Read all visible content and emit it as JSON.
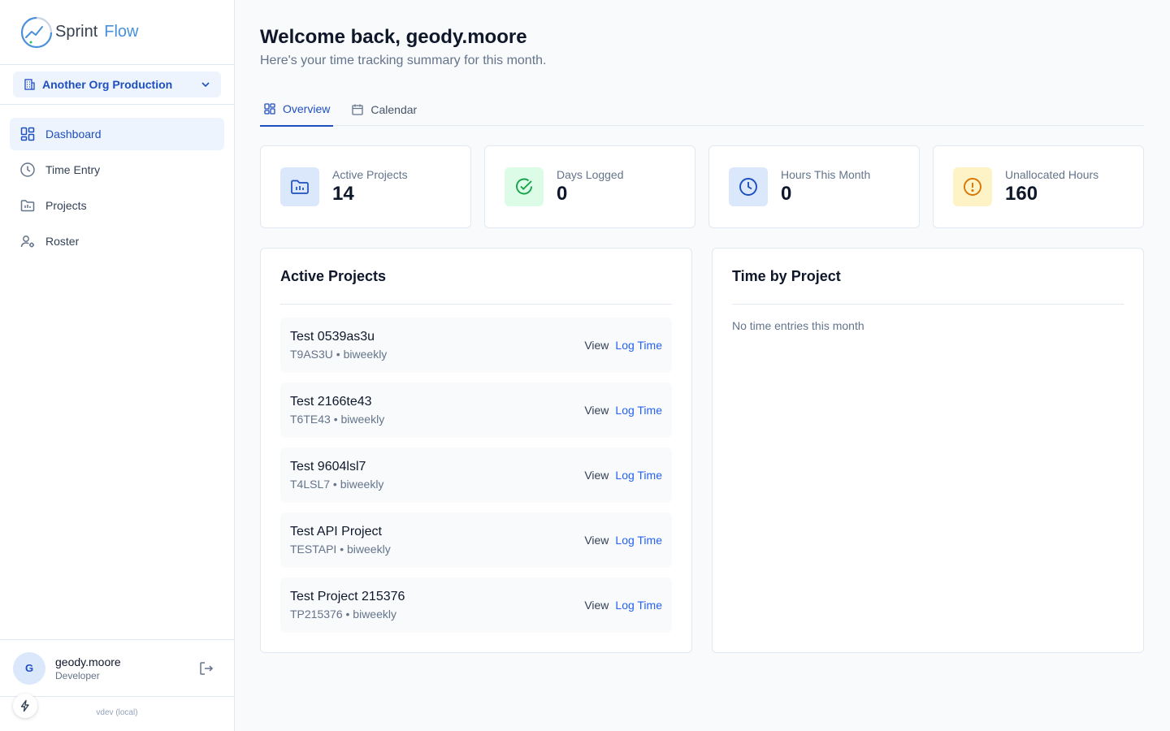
{
  "brand": {
    "part1": "Sprint",
    "part2": "Flow"
  },
  "org": {
    "selected": "Another Org Production"
  },
  "nav": [
    {
      "label": "Dashboard",
      "icon": "dashboard-icon",
      "active": true
    },
    {
      "label": "Time Entry",
      "icon": "clock-icon",
      "active": false
    },
    {
      "label": "Projects",
      "icon": "folder-icon",
      "active": false
    },
    {
      "label": "Roster",
      "icon": "users-icon",
      "active": false
    }
  ],
  "user": {
    "initial": "G",
    "name": "geody.moore",
    "role": "Developer",
    "version": "vdev (local)"
  },
  "header": {
    "title": "Welcome back, geody.moore",
    "subtitle": "Here's your time tracking summary for this month."
  },
  "tabs": [
    {
      "label": "Overview",
      "icon": "grid-icon",
      "active": true
    },
    {
      "label": "Calendar",
      "icon": "calendar-icon",
      "active": false
    }
  ],
  "stats": [
    {
      "label": "Active Projects",
      "value": "14",
      "icon": "folder-chart-icon",
      "bg": "#dbe7fb",
      "fg": "#1e4fbf"
    },
    {
      "label": "Days Logged",
      "value": "0",
      "icon": "check-circle-icon",
      "bg": "#dcfce7",
      "fg": "#16a34a"
    },
    {
      "label": "Hours This Month",
      "value": "0",
      "icon": "clock-icon",
      "bg": "#dbe7fb",
      "fg": "#1e4fbf"
    },
    {
      "label": "Unallocated Hours",
      "value": "160",
      "icon": "alert-circle-icon",
      "bg": "#fef3c7",
      "fg": "#d97706"
    }
  ],
  "active_projects": {
    "title": "Active Projects",
    "view_label": "View",
    "log_label": "Log Time",
    "items": [
      {
        "name": "Test 0539as3u",
        "code": "T9AS3U",
        "cadence": "biweekly"
      },
      {
        "name": "Test 2166te43",
        "code": "T6TE43",
        "cadence": "biweekly"
      },
      {
        "name": "Test 9604lsl7",
        "code": "T4LSL7",
        "cadence": "biweekly"
      },
      {
        "name": "Test API Project",
        "code": "TESTAPI",
        "cadence": "biweekly"
      },
      {
        "name": "Test Project 215376",
        "code": "TP215376",
        "cadence": "biweekly"
      }
    ]
  },
  "time_by_project": {
    "title": "Time by Project",
    "empty": "No time entries this month"
  }
}
